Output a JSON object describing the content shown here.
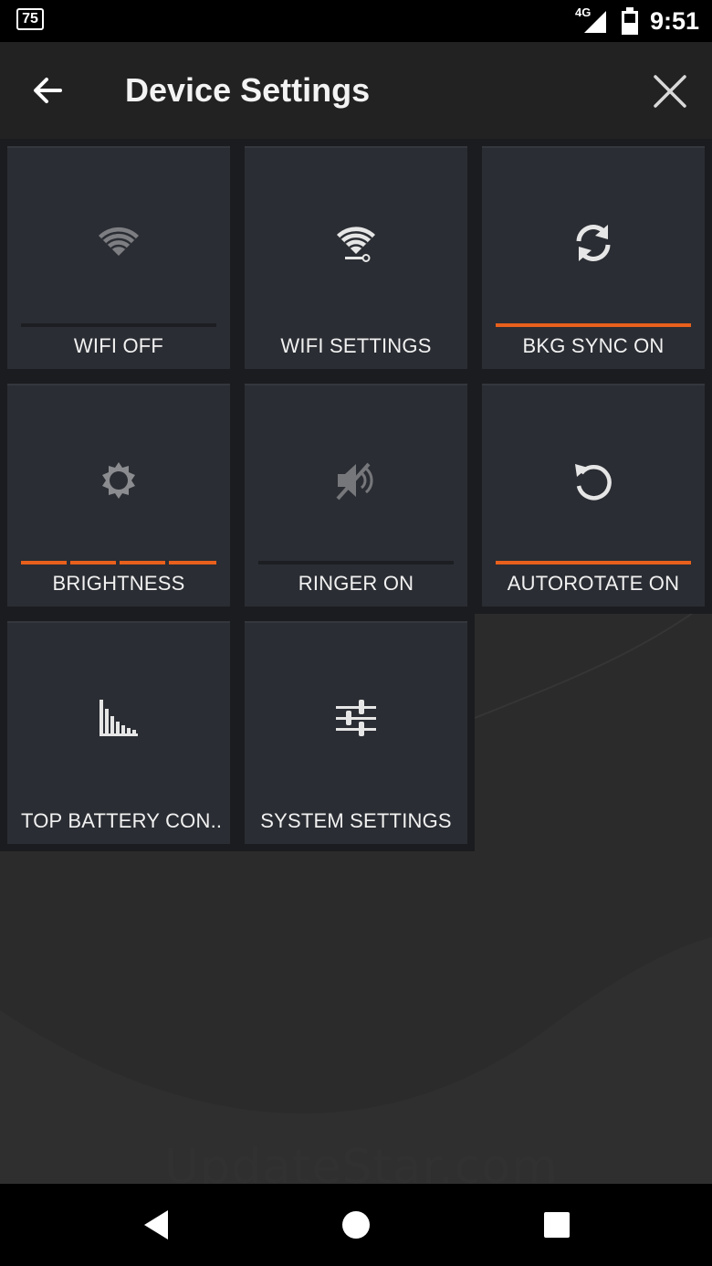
{
  "status_bar": {
    "notification_badge": "75",
    "network": "4G",
    "time": "9:51",
    "icons": [
      "signal-icon",
      "battery-icon"
    ]
  },
  "app_bar": {
    "title": "Device Settings",
    "back_icon": "arrow-left-icon",
    "close_icon": "close-icon"
  },
  "colors": {
    "accent": "#e8601c",
    "tile_bg": "#2a2d33",
    "bar_inactive": "#1c1e22",
    "icon_dim": "#8a8c8f",
    "icon_bright": "#e6e6e6"
  },
  "tiles": [
    {
      "label": "WIFI OFF",
      "icon": "wifi-icon",
      "state": "off"
    },
    {
      "label": "WIFI SETTINGS",
      "icon": "wifi-settings-icon"
    },
    {
      "label": "BKG SYNC ON",
      "icon": "sync-icon",
      "state": "on"
    },
    {
      "label": "BRIGHTNESS",
      "icon": "brightness-icon",
      "level": "4 of 4"
    },
    {
      "label": "RINGER ON",
      "icon": "ringer-muted-icon",
      "state": "off"
    },
    {
      "label": "AUTOROTATE ON",
      "icon": "rotate-icon",
      "state": "on"
    },
    {
      "label": "TOP BATTERY CON..",
      "icon": "battery-chart-icon"
    },
    {
      "label": "SYSTEM SETTINGS",
      "icon": "sliders-icon"
    }
  ],
  "watermark": "UpdateStar.com",
  "nav_bar": {
    "icons": [
      "back-triangle-icon",
      "home-circle-icon",
      "recents-square-icon"
    ]
  }
}
